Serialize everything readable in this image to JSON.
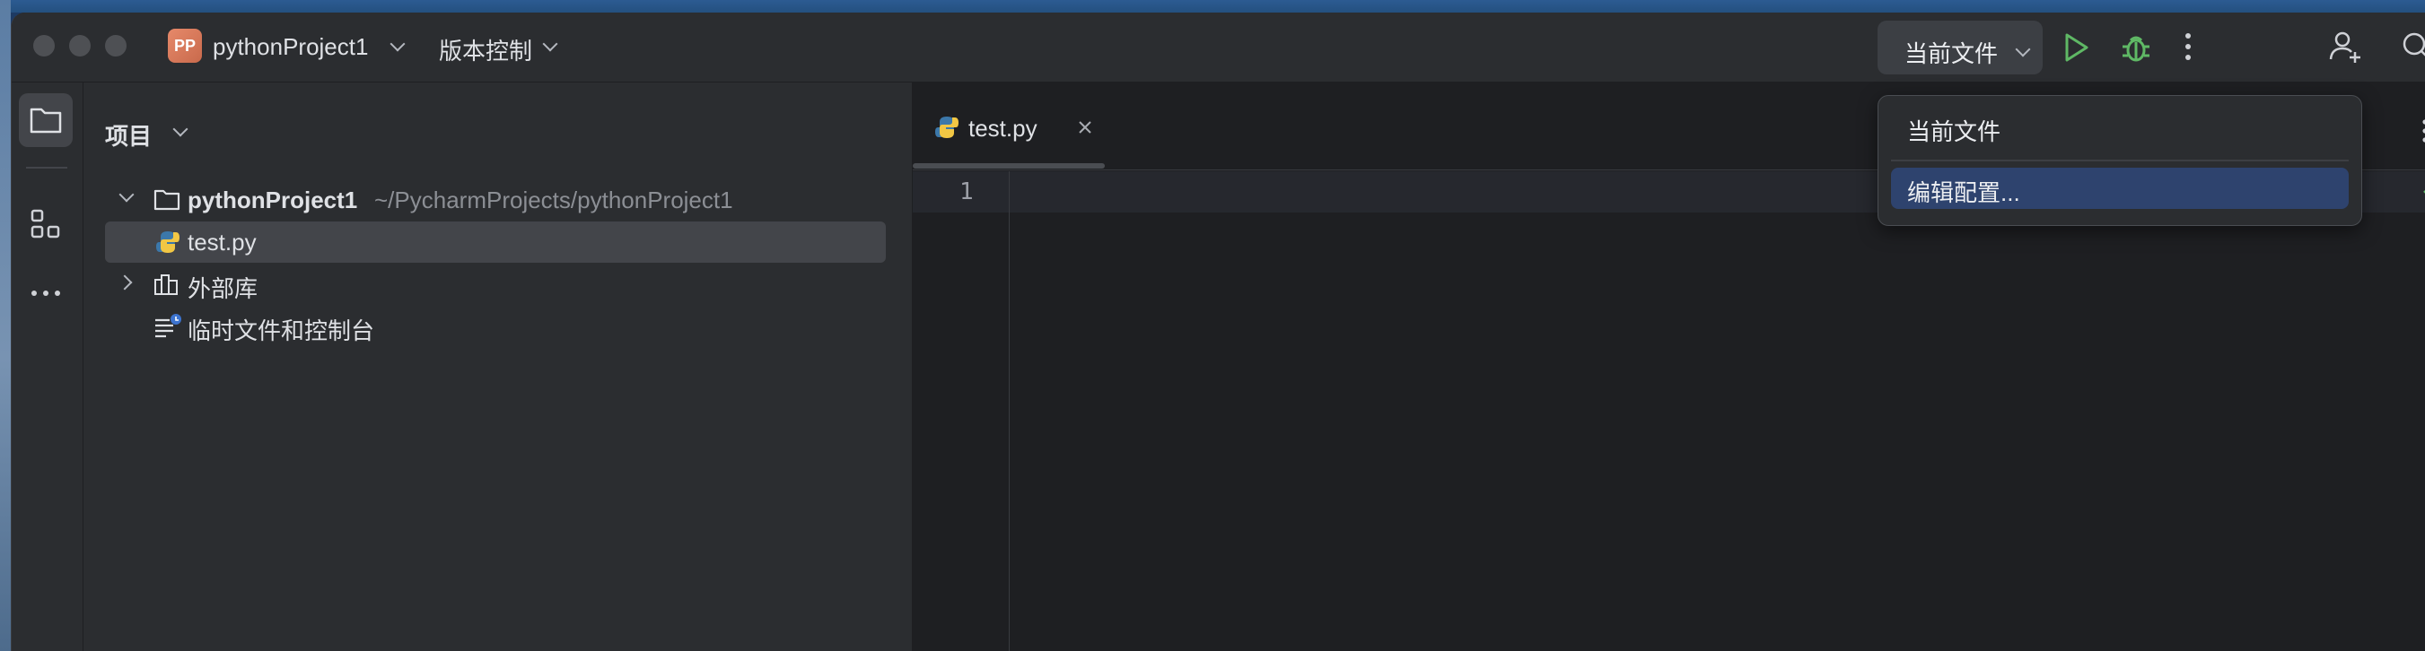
{
  "app": {
    "project_badge": "PP",
    "project_name": "pythonProject1",
    "vcs_menu": "版本控制"
  },
  "toolbar": {
    "run_config_label": "当前文件",
    "icons": [
      "run-icon",
      "debug-icon",
      "more-vertical-icon",
      "add-user-icon",
      "search-icon"
    ]
  },
  "project_panel": {
    "title": "项目",
    "tree": [
      {
        "label": "pythonProject1",
        "path": "~/PycharmProjects/pythonProject1",
        "expanded": true
      },
      {
        "label": "test.py",
        "selected": true
      },
      {
        "label": "外部库",
        "expanded": false
      },
      {
        "label": "临时文件和控制台"
      }
    ]
  },
  "editor": {
    "tabs": [
      {
        "label": "test.py",
        "active": true
      }
    ],
    "line_numbers": [
      "1"
    ]
  },
  "popup": {
    "items": [
      {
        "label": "当前文件",
        "highlighted": false
      },
      {
        "label": "编辑配置...",
        "highlighted": true
      }
    ]
  },
  "colors": {
    "accent_run": "#5fb865",
    "selection": "#2e436e",
    "project_badge": "#d9795b",
    "background": "#1e1f22",
    "panel": "#2b2d30"
  }
}
